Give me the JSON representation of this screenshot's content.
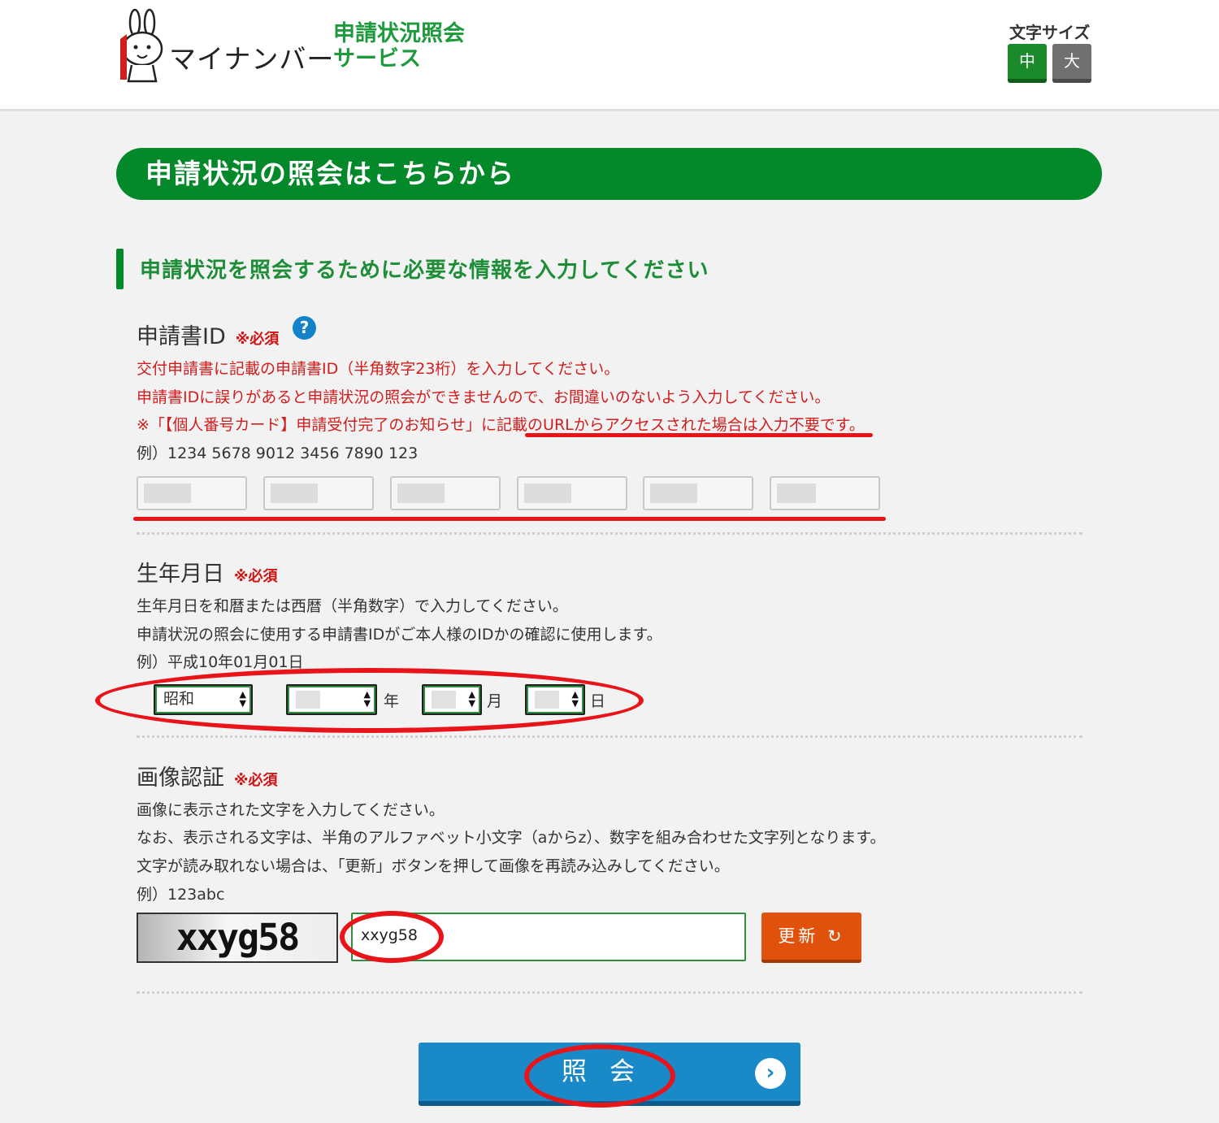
{
  "header": {
    "logo_text": "マイナンバー",
    "service_line1": "申請状況照会",
    "service_line2": "サービス",
    "font_size_label": "文字サイズ",
    "font_size_medium": "中",
    "font_size_large": "大"
  },
  "banner": {
    "title": "申請状況の照会はこちらから"
  },
  "section": {
    "heading": "申請状況を照会するために必要な情報を入力してください"
  },
  "application_id": {
    "label": "申請書ID",
    "required": "※必須",
    "help_icon": "?",
    "desc1": "交付申請書に記載の申請書ID（半角数字23桁）を入力してください。",
    "desc2": "申請書IDに誤りがあると申請状況の照会ができませんので、お間違いのないよう入力してください。",
    "desc3": "※「【個人番号カード】申請受付完了のお知らせ」に記載のURLからアクセスされた場合は入力不要です。",
    "example": "例）1234 5678 9012 3456 7890 123"
  },
  "birth_date": {
    "label": "生年月日",
    "required": "※必須",
    "desc1": "生年月日を和暦または西暦（半角数字）で入力してください。",
    "desc2": "申請状況の照会に使用する申請書IDがご本人様のIDかの確認に使用します。",
    "example": "例）平成10年01月01日",
    "era_value": "昭和",
    "unit_year": "年",
    "unit_month": "月",
    "unit_day": "日"
  },
  "captcha": {
    "label": "画像認証",
    "required": "※必須",
    "desc1": "画像に表示された文字を入力してください。",
    "desc2": "なお、表示される文字は、半角のアルファベット小文字（aからz）、数字を組み合わせた文字列となります。",
    "desc3": "文字が読み取れない場合は、「更新」ボタンを押して画像を再読み込みしてください。",
    "example": "例）123abc",
    "image_text": "xxyg58",
    "input_value": "xxyg58",
    "refresh_label": "更新 ↻"
  },
  "submit": {
    "label": "照会",
    "arrow": "›"
  },
  "colors": {
    "brand_green": "#04892a",
    "alert_red": "#d11d1d",
    "refresh_orange": "#e0520c",
    "submit_blue": "#1a89c8",
    "annotation_red": "#e8141a"
  },
  "icons": {
    "help": "question-circle-icon",
    "refresh": "refresh-icon",
    "submit": "chevron-right-circle-icon"
  }
}
